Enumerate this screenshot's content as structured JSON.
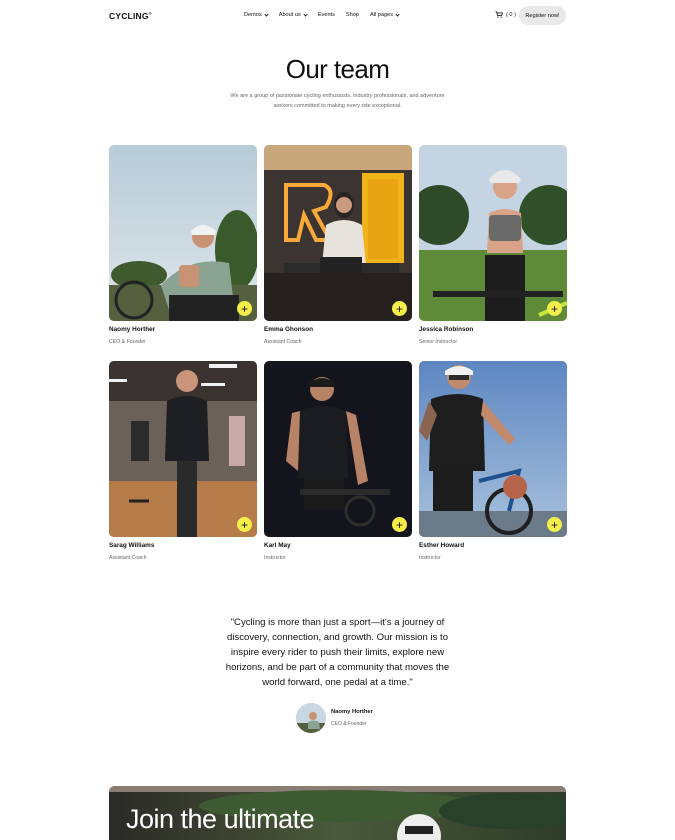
{
  "nav": {
    "logo": "CYCLING",
    "logo_mark": "®",
    "menu": [
      {
        "label": "Demos",
        "has_dropdown": true
      },
      {
        "label": "About us",
        "has_dropdown": true
      },
      {
        "label": "Events",
        "has_dropdown": false
      },
      {
        "label": "Shop",
        "has_dropdown": false
      },
      {
        "label": "All pages",
        "has_dropdown": true
      }
    ],
    "cart_count": "( 0 )",
    "register_label": "Register now!"
  },
  "hero": {
    "title": "Our team",
    "subtitle": "We are a group of passionate cycling enthusiasts, industry professionals, and adventure seekers committed to making every ride exceptional."
  },
  "team": [
    {
      "name": "Naomy Horther",
      "role": "CEO & Founder"
    },
    {
      "name": "Emma Ghonson",
      "role": "Assistant Coach"
    },
    {
      "name": "Jessica Robinson",
      "role": "Senior Instructor"
    },
    {
      "name": "Sarag Williams",
      "role": "Assistant Coach"
    },
    {
      "name": "Karl May",
      "role": "Instructor"
    },
    {
      "name": "Esther Howard",
      "role": "Instructor"
    }
  ],
  "plus_symbol": "+",
  "quote": {
    "text": "\"Cycling is more than just a sport—it's a journey of discovery, connection, and growth. Our mission is to inspire every rider to push their limits, explore new horizons, and be part of a community that moves the world forward, one pedal at a time.\"",
    "author_name": "Naomy Horther",
    "author_role": "CEO & Founder"
  },
  "banner": {
    "title": "Join the ultimate"
  },
  "colors": {
    "accent": "#f4ee4a",
    "text": "#111111",
    "muted": "#666666",
    "button_bg": "#e9e9e9"
  }
}
